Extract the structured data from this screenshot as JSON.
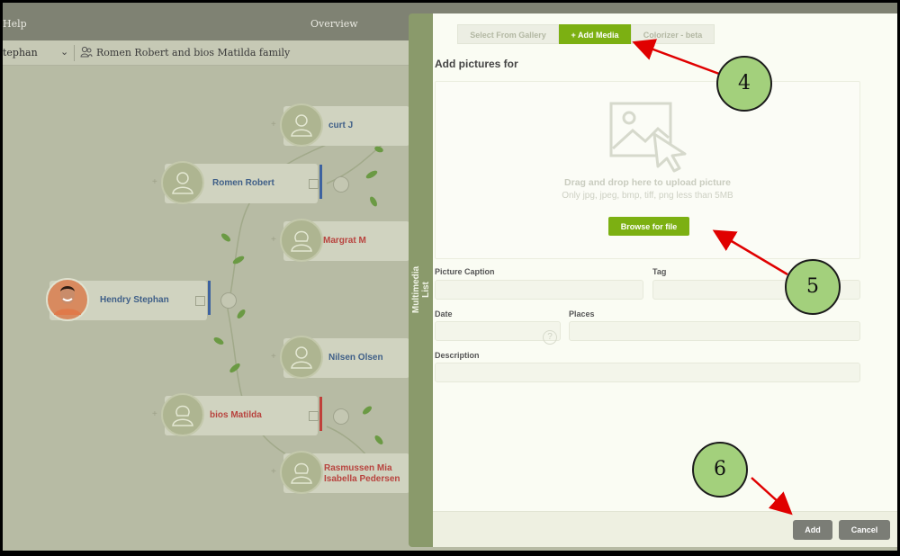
{
  "app": {
    "menu_help": "Help",
    "overview": "Overview",
    "current_person": "tephan",
    "family_label": "Romen Robert and bios Matilda family"
  },
  "tree": {
    "nodes": [
      {
        "name": "curt J",
        "color": "blue"
      },
      {
        "name": "Romen Robert",
        "color": "blue"
      },
      {
        "name": "Margrat M",
        "color": "red"
      },
      {
        "name": "Hendry Stephan",
        "color": "blue"
      },
      {
        "name": "Nilsen Olsen",
        "color": "blue"
      },
      {
        "name": "bios Matilda",
        "color": "red"
      },
      {
        "name": "Rasmussen Mia Isabella Pedersen",
        "color": "red",
        "lines": [
          "Rasmussen Mia",
          "Isabella Pedersen"
        ]
      }
    ]
  },
  "dialog": {
    "side_tab": "Multimedia List",
    "tabs": [
      {
        "label": "Select From Gallery",
        "active": false
      },
      {
        "label": "+ Add Media",
        "active": true
      },
      {
        "label": "Colorizer - beta",
        "active": false
      }
    ],
    "heading": "Add pictures for",
    "dropzone": {
      "line1": "Drag and drop here to upload picture",
      "line2": "Only jpg, jpeg, bmp, tiff, png less than 5MB",
      "browse": "Browse for file"
    },
    "fields": {
      "caption_label": "Picture Caption",
      "tag_label": "Tag",
      "date_label": "Date",
      "places_label": "Places",
      "description_label": "Description",
      "help_glyph": "?"
    },
    "buttons": {
      "add": "Add",
      "cancel": "Cancel"
    }
  },
  "annotations": [
    "4",
    "5",
    "6"
  ],
  "colors": {
    "accent_green": "#7cb012",
    "arrow_red": "#e00000",
    "callout_fill": "#a3d07c",
    "name_blue": "#3f5f88",
    "name_red": "#b8433e"
  }
}
